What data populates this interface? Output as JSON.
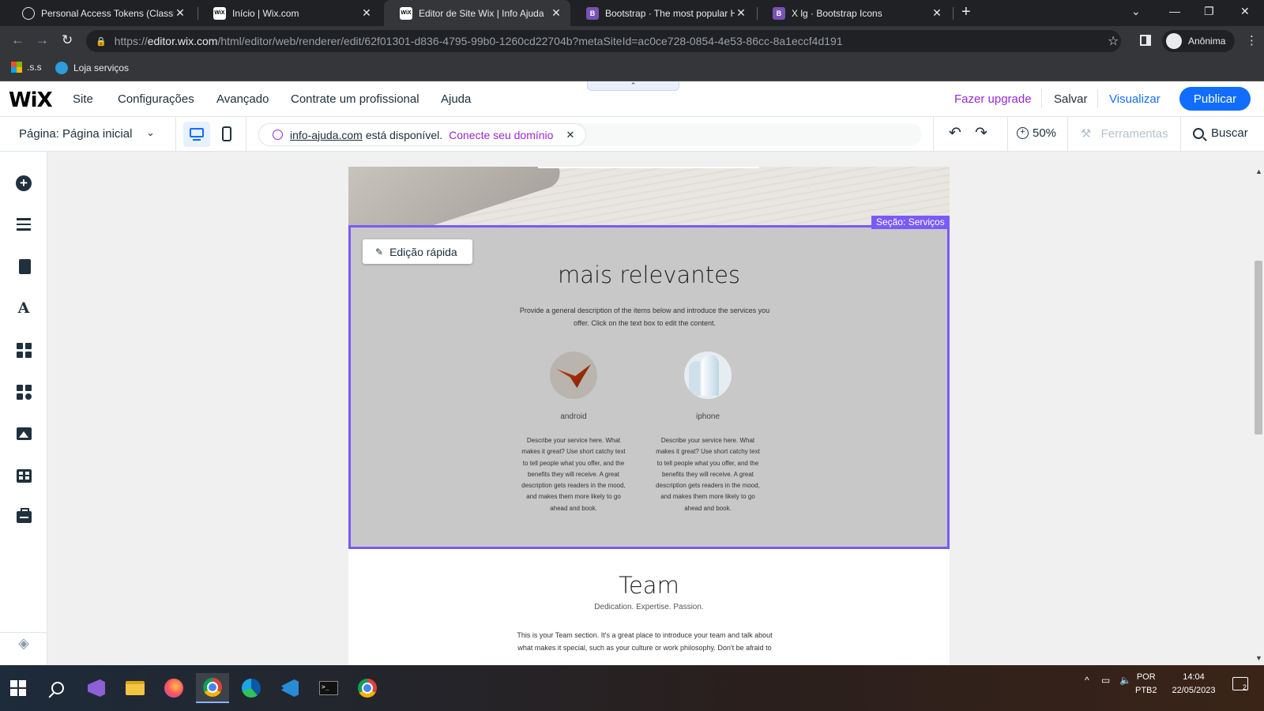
{
  "browser": {
    "tabs": [
      {
        "title": "Personal Access Tokens (Classic)",
        "favicon": "github-icon",
        "active": false
      },
      {
        "title": "Início | Wix.com",
        "favicon": "wix-icon",
        "active": false
      },
      {
        "title": "Editor de Site Wix | Info Ajuda",
        "favicon": "wix-icon",
        "active": true
      },
      {
        "title": "Bootstrap · The most popular HTML",
        "favicon": "bootstrap-icon",
        "active": false
      },
      {
        "title": "X lg · Bootstrap Icons",
        "favicon": "bootstrap-icon",
        "active": false
      }
    ],
    "favicon_text": {
      "wix": "WiX",
      "bootstrap": "B"
    },
    "url_prefix": "https://",
    "url_host": "editor.wix.com",
    "url_path": "/html/editor/web/renderer/edit/62f01301-d836-4795-99b0-1260cd22704b?metaSiteId=ac0ce728-0854-4e53-86cc-8a1eccf4d191",
    "profile_label": "Anônima",
    "bookmarks": [
      ".s.s",
      "Loja serviços"
    ]
  },
  "wix": {
    "logo": "WiX",
    "menu": [
      "Site",
      "Configurações",
      "Avançado",
      "Contrate um profissional",
      "Ajuda"
    ],
    "upgrade": "Fazer upgrade",
    "save": "Salvar",
    "preview": "Visualizar",
    "publish": "Publicar",
    "page_selector": "Página: Página inicial",
    "domain_name": "info-ajuda.com",
    "domain_available": "está disponível.",
    "domain_connect": "Conecte seu domínio",
    "zoom": "50%",
    "tools": "Ferramentas",
    "search": "Buscar"
  },
  "canvas": {
    "section_label": "Seção: Serviços",
    "quick_edit": "Edição rápida",
    "services_title": "mais relevantes",
    "services_description": "Provide a general description of the items below and introduce the services you offer. Click on the text box to edit the content.",
    "services": [
      {
        "name": "android",
        "text": "Describe your service here. What makes it great? Use short catchy text to tell people what you offer, and the benefits they will receive. A great description gets readers in the mood, and makes them more likely to go ahead and book."
      },
      {
        "name": "iphone",
        "text": "Describe your service here. What makes it great? Use short catchy text to tell people what you offer, and the benefits they will receive. A great description gets readers in the mood, and makes them more likely to go ahead and book."
      }
    ],
    "team_title": "Team",
    "team_subtitle": "Dedication. Expertise. Passion.",
    "team_description": "This is your Team section. It's a great place to introduce your team and talk about what makes it special, such as your culture or work philosophy. Don't be afraid to"
  },
  "taskbar": {
    "lang_line1": "POR",
    "lang_line2": "PTB2",
    "time": "14:04",
    "date": "22/05/2023",
    "notifications": "2"
  },
  "colors": {
    "wix_blue": "#116dff",
    "wix_purple": "#9a27d5",
    "selection": "#7a5af8",
    "section_bg": "#c8c8c8"
  }
}
